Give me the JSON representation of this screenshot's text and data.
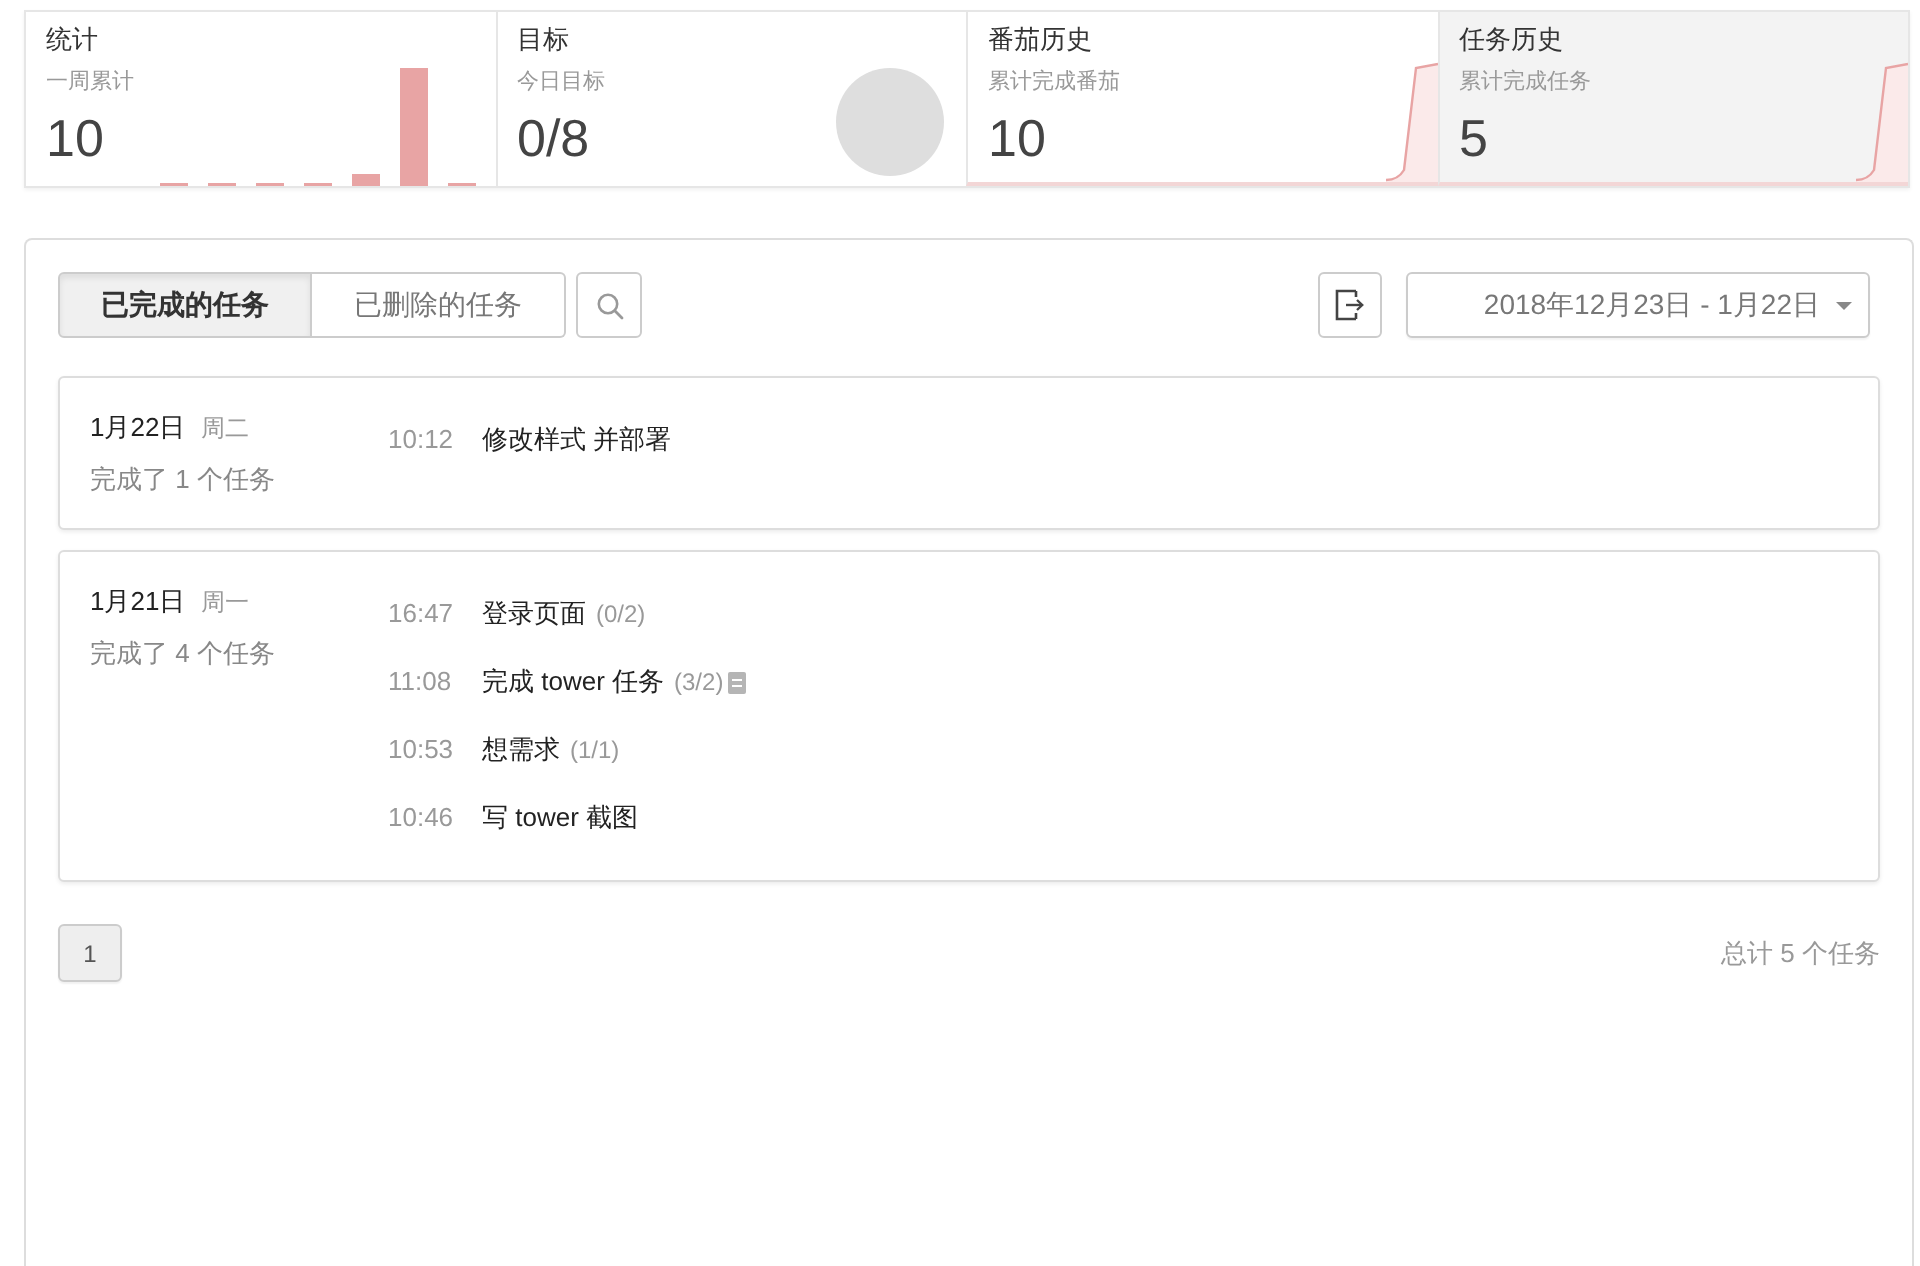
{
  "stat_cards": [
    {
      "title": "统计",
      "subtitle": "一周累计",
      "value": "10",
      "kind": "bars",
      "selected": false
    },
    {
      "title": "目标",
      "subtitle": "今日目标",
      "value": "0/8",
      "kind": "ring",
      "selected": false
    },
    {
      "title": "番茄历史",
      "subtitle": "累计完成番茄",
      "value": "10",
      "kind": "sparkline",
      "selected": false
    },
    {
      "title": "任务历史",
      "subtitle": "累计完成任务",
      "value": "5",
      "kind": "sparkline",
      "selected": true
    }
  ],
  "tabs": [
    {
      "label": "已完成的任务",
      "selected": true
    },
    {
      "label": "已删除的任务",
      "selected": false
    }
  ],
  "date_range": {
    "value": "2018年12月23日 - 1月22日"
  },
  "days": [
    {
      "date": "1月22日",
      "weekday": "周二",
      "summary": "完成了 1 个任务",
      "tasks": [
        {
          "time": "10:12",
          "title": "修改样式 并部署",
          "has_note": false
        }
      ]
    },
    {
      "date": "1月21日",
      "weekday": "周一",
      "summary": "完成了 4 个任务",
      "tasks": [
        {
          "time": "16:47",
          "title": "登录页面",
          "progress": "(0/2)",
          "has_note": false
        },
        {
          "time": "11:08",
          "title": "完成 tower 任务",
          "progress": "(3/2)",
          "has_note": true
        },
        {
          "time": "10:53",
          "title": "想需求",
          "progress": "(1/1)",
          "has_note": false
        },
        {
          "time": "10:46",
          "title": "写 tower 截图",
          "has_note": false
        }
      ]
    }
  ],
  "pagination": {
    "pages": [
      {
        "label": "1",
        "selected": true
      }
    ]
  },
  "total": "总计 5 个任务"
}
